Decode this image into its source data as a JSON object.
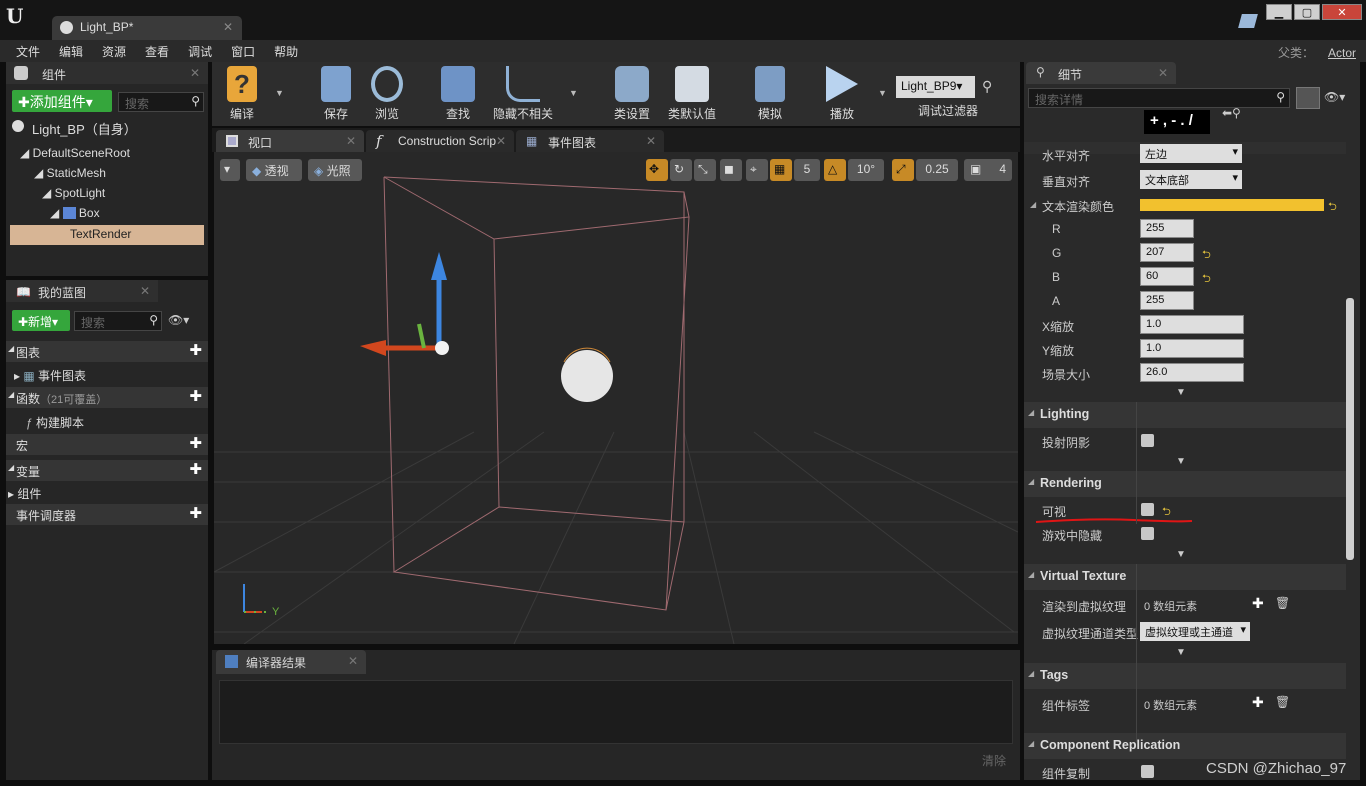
{
  "titlebar": {
    "doc_tab": "Light_BP*"
  },
  "menu": [
    "文件",
    "编辑",
    "资源",
    "查看",
    "调试",
    "窗口",
    "帮助"
  ],
  "parent_class": {
    "label": "父类：",
    "value": "Actor"
  },
  "components_panel": {
    "title": "组件",
    "add_button": "✚添加组件▾",
    "search_placeholder": "搜索",
    "self_label": "Light_BP（自身）",
    "tree": [
      {
        "label": "DefaultSceneRoot"
      },
      {
        "label": "StaticMesh"
      },
      {
        "label": "SpotLight"
      },
      {
        "label": "Box"
      },
      {
        "label": "TextRender"
      }
    ]
  },
  "blueprint_panel": {
    "title": "我的蓝图",
    "new_button": "✚新增▾",
    "search_placeholder": "搜索",
    "sections": {
      "graph": "图表",
      "event_graph": "事件图表",
      "functions": "函数",
      "functions_count": "（21可覆盖）",
      "construction_script": "构建脚本",
      "macro": "宏",
      "variables": "变量",
      "components": "组件",
      "dispatchers": "事件调度器"
    }
  },
  "toolbar": {
    "compile": "编译",
    "save": "保存",
    "browse": "浏览",
    "find": "查找",
    "hide_unrelated": "隐藏不相关",
    "class_settings": "类设置",
    "class_defaults": "类默认值",
    "simulate": "模拟",
    "play": "播放",
    "debug_object": "Light_BP9▾",
    "debug_filter": "调试过滤器"
  },
  "viewport_tabs": [
    "视口",
    "Construction Scrip",
    "事件图表"
  ],
  "viewport": {
    "perspective": "透视",
    "lit": "光照",
    "grid_snap": "5",
    "rot_snap": "10°",
    "scale_snap": "0.25",
    "cam_speed": "4",
    "axis_y": "Y"
  },
  "compiler": {
    "title": "编译器结果",
    "clear": "清除"
  },
  "details": {
    "title": "细节",
    "search_placeholder": "搜索详情",
    "text_preview": "+ , - . /",
    "rows": {
      "halign_label": "水平对齐",
      "halign_value": "左边",
      "valign_label": "垂直对齐",
      "valign_value": "文本底部",
      "color_label": "文本渲染颜色",
      "r_label": "R",
      "r_value": "255",
      "g_label": "G",
      "g_value": "207",
      "b_label": "B",
      "b_value": "60",
      "a_label": "A",
      "a_value": "255",
      "xscale_label": "X缩放",
      "xscale_value": "1.0",
      "yscale_label": "Y缩放",
      "yscale_value": "1.0",
      "worldsize_label": "场景大小",
      "worldsize_value": "26.0"
    },
    "lighting": {
      "title": "Lighting",
      "cast_shadow": "投射阴影"
    },
    "rendering": {
      "title": "Rendering",
      "visible": "可视",
      "hidden_in_game": "游戏中隐藏"
    },
    "virtual_texture": {
      "title": "Virtual Texture",
      "render_to": "渲染到虚拟纹理",
      "render_to_value": "0 数组元素",
      "pass_type": "虚拟纹理通道类型",
      "pass_type_value": "虚拟纹理或主通道"
    },
    "tags": {
      "title": "Tags",
      "component_tags": "组件标签",
      "value": "0 数组元素"
    },
    "replication": {
      "title": "Component Replication",
      "replicates": "组件复制"
    },
    "text_color_hex": "#f2c12e"
  },
  "watermark": "CSDN @Zhichao_97"
}
